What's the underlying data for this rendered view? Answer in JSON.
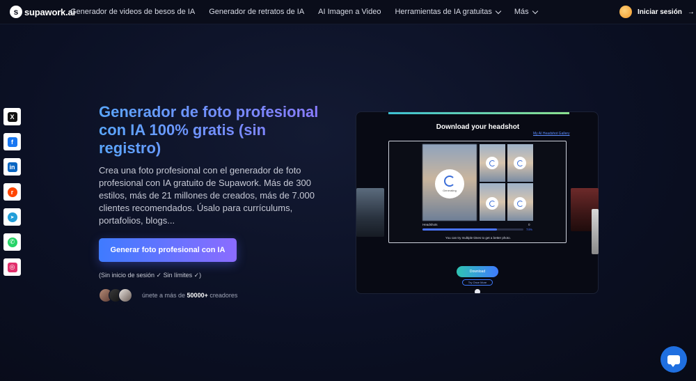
{
  "nav": {
    "logo_text": "supawork.ai",
    "links": [
      {
        "label": "Generador de videos de besos de IA"
      },
      {
        "label": "Generador de retratos de IA"
      },
      {
        "label": "AI Imagen a Video"
      },
      {
        "label": "Herramientas de IA gratuitas"
      },
      {
        "label": "Más"
      }
    ],
    "login_label": "Iniciar sesión",
    "login_arrow": "→"
  },
  "social": [
    {
      "name": "x-icon",
      "glyph": "X",
      "color": "#111111"
    },
    {
      "name": "facebook-icon",
      "glyph": "f",
      "color": "#1877f2"
    },
    {
      "name": "linkedin-icon",
      "glyph": "in",
      "color": "#0a66c2"
    },
    {
      "name": "reddit-icon",
      "glyph": "r",
      "color": "#ff4500"
    },
    {
      "name": "telegram-icon",
      "glyph": "➤",
      "color": "#229ed9"
    },
    {
      "name": "whatsapp-icon",
      "glyph": "✆",
      "color": "#25d366"
    },
    {
      "name": "instagram-icon",
      "glyph": "◎",
      "color": "#e1306c"
    }
  ],
  "hero": {
    "title": "Generador de foto profesional con IA 100% gratis (sin registro)",
    "description": "Crea una foto profesional con el generador de foto profesional con IA gratuito de Supawork. Más de 300 estilos, más de 21 millones de creados, más de 7.000 clientes recomendados. Úsalo para currículums, portafolios, blogs...",
    "cta_label": "Generar foto profesional con IA",
    "cta_note": "(Sin inicio de sesión ✓ Sin límites ✓)",
    "creators_prefix": "únete a más de ",
    "creators_count": "50000+",
    "creators_suffix": " creadores"
  },
  "preview": {
    "title": "Download your headshot",
    "gallery_link": "My AI Headshot Gallery",
    "generating_label": "Generating",
    "headshots_label": "Headshots",
    "headshots_count": "0",
    "progress_percent": 74,
    "progress_text": "74%",
    "hint": "You can try multiple times to get a better photo.",
    "download_label": "Download",
    "try_label": "Try Once More"
  },
  "colors": {
    "accent_blue": "#3f7bff",
    "accent_purple": "#8b6cff",
    "chat": "#1f6fe0"
  }
}
